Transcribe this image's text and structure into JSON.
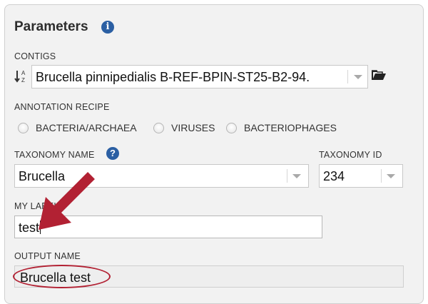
{
  "panel": {
    "title": "Parameters"
  },
  "contigs": {
    "label": "CONTIGS",
    "value": "Brucella pinnipedialis B-REF-BPIN-ST25-B2-94."
  },
  "annotation_recipe": {
    "label": "ANNOTATION RECIPE",
    "options": [
      {
        "label": "BACTERIA/ARCHAEA",
        "selected": false
      },
      {
        "label": "VIRUSES",
        "selected": false
      },
      {
        "label": "BACTERIOPHAGES",
        "selected": false
      }
    ]
  },
  "taxonomy_name": {
    "label": "TAXONOMY NAME",
    "value": "Brucella"
  },
  "taxonomy_id": {
    "label": "TAXONOMY ID",
    "value": "234"
  },
  "my_label": {
    "label": "MY LABEL",
    "value": "test"
  },
  "output_name": {
    "label": "OUTPUT NAME",
    "value": "Brucella test"
  },
  "icons": {
    "info": "info-icon",
    "help": "help-icon",
    "sort": "sort-az-icon",
    "folder": "folder-open-icon",
    "caret": "chevron-down-icon"
  },
  "colors": {
    "accent": "#2b5fa3",
    "annotation_red": "#b22133"
  }
}
